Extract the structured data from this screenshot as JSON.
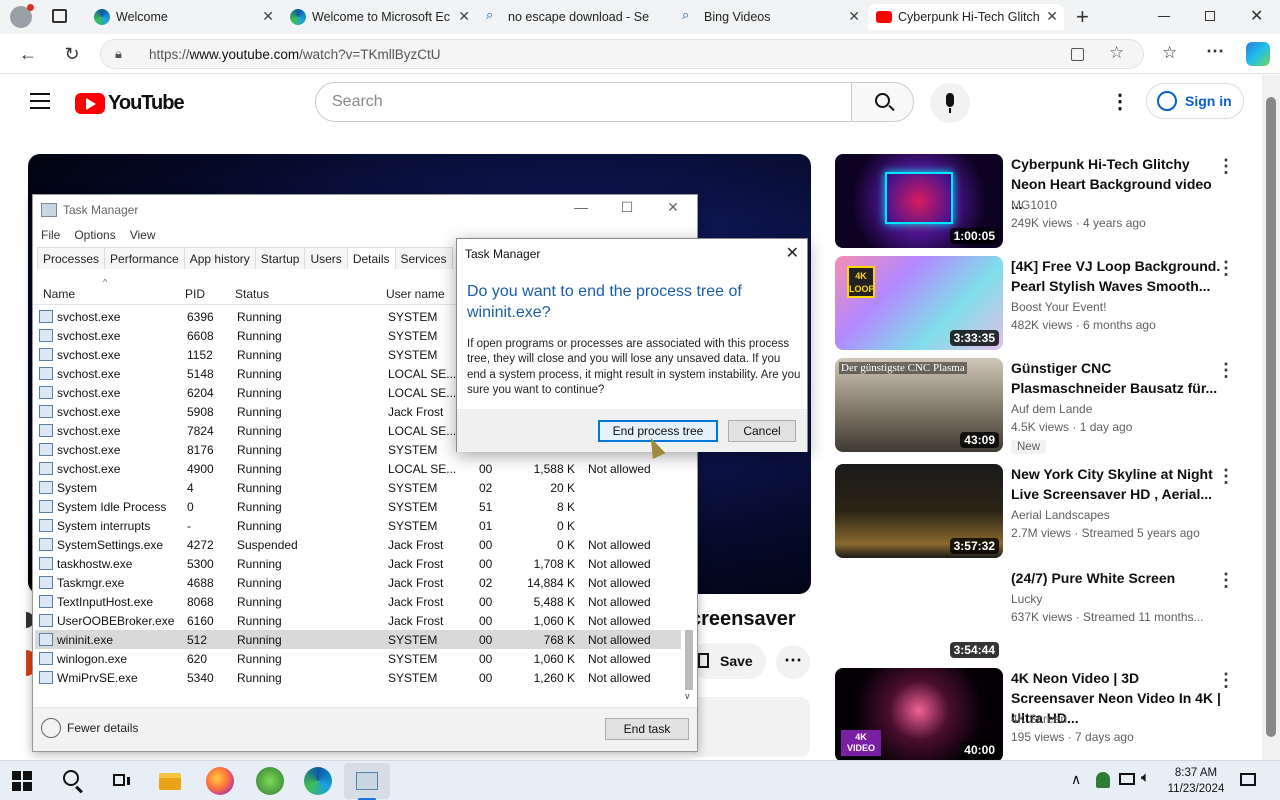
{
  "browser": {
    "tabs": [
      {
        "title": "Welcome"
      },
      {
        "title": "Welcome to Microsoft Ec"
      },
      {
        "title": "no escape download - Se"
      },
      {
        "title": "Bing Videos"
      },
      {
        "title": "Cyberpunk Hi-Tech Glitch"
      }
    ],
    "url_prefix": "https://",
    "url_domain": "www.youtube.com",
    "url_path": "/watch?v=TKmllByzCtU"
  },
  "youtube": {
    "logo_text": "YouTube",
    "search_placeholder": "Search",
    "signin_label": "Sign in",
    "video_title_partial": "creensaver",
    "save_label": "Save",
    "recommendations": [
      {
        "title": "Cyberpunk Hi-Tech Glitchy Neon Heart Background video ...",
        "channel": "MG1010",
        "meta": "249K views · 4 years ago",
        "duration": "1:00:05",
        "badge": ""
      },
      {
        "title": "[4K] Free VJ Loop Background. Pearl Stylish Waves Smooth...",
        "channel": "Boost Your Event!",
        "meta": "482K views · 6 months ago",
        "duration": "3:33:35",
        "badge": ""
      },
      {
        "title": "Günstiger CNC Plasmaschneider Bausatz für...",
        "channel": "Auf dem Lande",
        "meta": "4.5K views · 1 day ago",
        "duration": "43:09",
        "badge": "New"
      },
      {
        "title": "New York City Skyline at Night Live Screensaver HD , Aerial...",
        "channel": "Aerial Landscapes",
        "meta": "2.7M views · Streamed 5 years ago",
        "duration": "3:57:32",
        "badge": ""
      },
      {
        "title": "(24/7) Pure White Screen",
        "channel": "Lucky",
        "meta": "637K views · Streamed 11 months...",
        "duration": "3:54:44",
        "badge": ""
      },
      {
        "title": "4K Neon Video | 3D Screensaver Neon Video In 4K | Ultra HD...",
        "channel": "4K Screen",
        "meta": "195 views · 7 days ago",
        "duration": "40:00",
        "badge": ""
      }
    ],
    "thumb_texts": {
      "loop_badge": "4K LOOP",
      "cnc_caption": "Der günstigste CNC Plasma",
      "video_badge": "4K VIDEO"
    }
  },
  "task_manager": {
    "title": "Task Manager",
    "menu": [
      "File",
      "Options",
      "View"
    ],
    "tabs": [
      "Processes",
      "Performance",
      "App history",
      "Startup",
      "Users",
      "Details",
      "Services"
    ],
    "active_tab": "Details",
    "columns": [
      "Name",
      "PID",
      "Status",
      "User name"
    ],
    "rows": [
      {
        "name": "svchost.exe",
        "pid": "6396",
        "status": "Running",
        "user": "SYSTEM",
        "cpu": "",
        "mem": "",
        "uac": ""
      },
      {
        "name": "svchost.exe",
        "pid": "6608",
        "status": "Running",
        "user": "SYSTEM",
        "cpu": "",
        "mem": "",
        "uac": ""
      },
      {
        "name": "svchost.exe",
        "pid": "1152",
        "status": "Running",
        "user": "SYSTEM",
        "cpu": "",
        "mem": "",
        "uac": ""
      },
      {
        "name": "svchost.exe",
        "pid": "5148",
        "status": "Running",
        "user": "LOCAL SE...",
        "cpu": "",
        "mem": "",
        "uac": ""
      },
      {
        "name": "svchost.exe",
        "pid": "6204",
        "status": "Running",
        "user": "LOCAL SE...",
        "cpu": "",
        "mem": "",
        "uac": ""
      },
      {
        "name": "svchost.exe",
        "pid": "5908",
        "status": "Running",
        "user": "Jack Frost",
        "cpu": "",
        "mem": "",
        "uac": ""
      },
      {
        "name": "svchost.exe",
        "pid": "7824",
        "status": "Running",
        "user": "LOCAL SE...",
        "cpu": "",
        "mem": "",
        "uac": ""
      },
      {
        "name": "svchost.exe",
        "pid": "8176",
        "status": "Running",
        "user": "SYSTEM",
        "cpu": "",
        "mem": "",
        "uac": ""
      },
      {
        "name": "svchost.exe",
        "pid": "4900",
        "status": "Running",
        "user": "LOCAL SE...",
        "cpu": "00",
        "mem": "1,588 K",
        "uac": "Not allowed"
      },
      {
        "name": "System",
        "pid": "4",
        "status": "Running",
        "user": "SYSTEM",
        "cpu": "02",
        "mem": "20 K",
        "uac": ""
      },
      {
        "name": "System Idle Process",
        "pid": "0",
        "status": "Running",
        "user": "SYSTEM",
        "cpu": "51",
        "mem": "8 K",
        "uac": ""
      },
      {
        "name": "System interrupts",
        "pid": "-",
        "status": "Running",
        "user": "SYSTEM",
        "cpu": "01",
        "mem": "0 K",
        "uac": ""
      },
      {
        "name": "SystemSettings.exe",
        "pid": "4272",
        "status": "Suspended",
        "user": "Jack Frost",
        "cpu": "00",
        "mem": "0 K",
        "uac": "Not allowed"
      },
      {
        "name": "taskhostw.exe",
        "pid": "5300",
        "status": "Running",
        "user": "Jack Frost",
        "cpu": "00",
        "mem": "1,708 K",
        "uac": "Not allowed"
      },
      {
        "name": "Taskmgr.exe",
        "pid": "4688",
        "status": "Running",
        "user": "Jack Frost",
        "cpu": "02",
        "mem": "14,884 K",
        "uac": "Not allowed"
      },
      {
        "name": "TextInputHost.exe",
        "pid": "8068",
        "status": "Running",
        "user": "Jack Frost",
        "cpu": "00",
        "mem": "5,488 K",
        "uac": "Not allowed"
      },
      {
        "name": "UserOOBEBroker.exe",
        "pid": "6160",
        "status": "Running",
        "user": "Jack Frost",
        "cpu": "00",
        "mem": "1,060 K",
        "uac": "Not allowed"
      },
      {
        "name": "wininit.exe",
        "pid": "512",
        "status": "Running",
        "user": "SYSTEM",
        "cpu": "00",
        "mem": "768 K",
        "uac": "Not allowed"
      },
      {
        "name": "winlogon.exe",
        "pid": "620",
        "status": "Running",
        "user": "SYSTEM",
        "cpu": "00",
        "mem": "1,060 K",
        "uac": "Not allowed"
      },
      {
        "name": "WmiPrvSE.exe",
        "pid": "5340",
        "status": "Running",
        "user": "SYSTEM",
        "cpu": "00",
        "mem": "1,260 K",
        "uac": "Not allowed"
      }
    ],
    "selected_row": "wininit.exe",
    "fewer_details": "Fewer details",
    "end_task": "End task"
  },
  "dialog": {
    "title": "Task Manager",
    "heading": "Do you want to end the process tree of wininit.exe?",
    "body": "If open programs or processes are associated with this process tree, they will close and you will lose any unsaved data. If you end a system process, it might result in system instability. Are you sure you want to continue?",
    "confirm": "End process tree",
    "cancel": "Cancel"
  },
  "taskbar": {
    "time": "8:37 AM",
    "date": "11/23/2024"
  }
}
